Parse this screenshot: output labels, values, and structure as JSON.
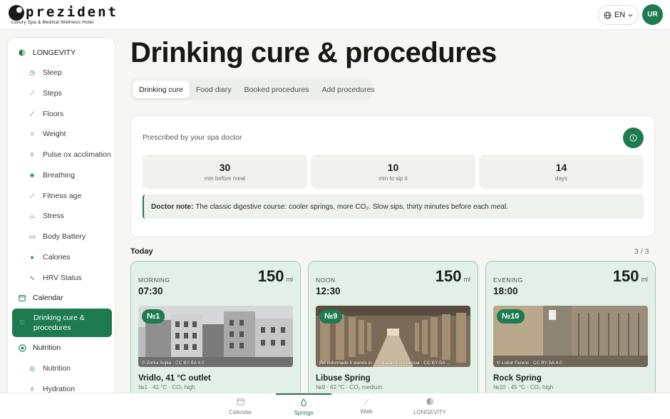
{
  "brand": {
    "name": "prezident",
    "tagline": "Luxury Spa & Medical Wellness Hotel"
  },
  "header": {
    "language": "EN",
    "avatar_initials": "UR"
  },
  "sidebar": {
    "group_title": "LONGEVITY",
    "items": [
      {
        "label": "Sleep",
        "icon": "clock-icon"
      },
      {
        "label": "Steps",
        "icon": "walk-icon"
      },
      {
        "label": "Floors",
        "icon": "stairs-icon"
      },
      {
        "label": "Weight",
        "icon": "scale-icon"
      },
      {
        "label": "Pulse ox acclimation",
        "icon": "drop-icon"
      },
      {
        "label": "Breathing",
        "icon": "lungs-icon"
      },
      {
        "label": "Fitness age",
        "icon": "runner-icon"
      },
      {
        "label": "Stress",
        "icon": "gauge-icon"
      },
      {
        "label": "Body Battery",
        "icon": "battery-icon"
      },
      {
        "label": "Calories",
        "icon": "flame-icon"
      },
      {
        "label": "HRV Status",
        "icon": "pulse-icon"
      }
    ],
    "calendar": "Calendar",
    "active": "Drinking cure & procedures",
    "nutrition_group": "Nutrition",
    "nutrition_items": [
      {
        "label": "Nutrition",
        "icon": "target-icon"
      },
      {
        "label": "Hydration",
        "icon": "drop-icon"
      }
    ]
  },
  "page": {
    "title": "Drinking cure & procedures",
    "tabs": [
      "Drinking cure",
      "Food diary",
      "Booked procedures",
      "Add procedures"
    ],
    "active_tab": "Drinking cure"
  },
  "prescription": {
    "title": "Prescribed by your spa doctor",
    "stats": [
      {
        "value": "30",
        "label": "min before meal"
      },
      {
        "value": "10",
        "label": "min to sip it"
      },
      {
        "value": "14",
        "label": "days"
      }
    ],
    "note_label": "Doctor note:",
    "note_text": "The classic digestive course: cooler springs, more CO₂. Slow sips, thirty minutes before each meal."
  },
  "today": {
    "title": "Today",
    "counter": "3 / 3",
    "doses": [
      {
        "period": "MORNING",
        "time": "07:30",
        "amount": "150",
        "unit": "ml",
        "badge": "№1",
        "credit": "© Zorka Šojka · CC BY-SA 4.0",
        "name": "Vridlo, 41 °C outlet",
        "meta": "№1 · 41 °C · CO₂ high"
      },
      {
        "period": "NOON",
        "time": "12:30",
        "amount": "150",
        "unit": "ml",
        "badge": "№9",
        "credit": "the colonnade it stands in · © MadamLochnessia · CC BY-SA ...",
        "name": "Libuse Spring",
        "meta": "№9 · 62 °C · CO₂ medium"
      },
      {
        "period": "EVENING",
        "time": "18:00",
        "amount": "150",
        "unit": "ml",
        "badge": "№10",
        "credit": "© Lubor Ferenc · CC BY-SA 4.0",
        "name": "Rock Spring",
        "meta": "№10 · 45 °C · CO₂ high"
      }
    ]
  },
  "bottom_nav": [
    {
      "label": "Calendar",
      "icon": "calendar-icon"
    },
    {
      "label": "Springs",
      "icon": "drop-icon"
    },
    {
      "label": "Walk",
      "icon": "walk-icon"
    },
    {
      "label": "LONGEVITY",
      "icon": "longevity-icon"
    }
  ],
  "colors": {
    "accent": "#1e7a4f",
    "card_tint": "#e3f0e7"
  }
}
